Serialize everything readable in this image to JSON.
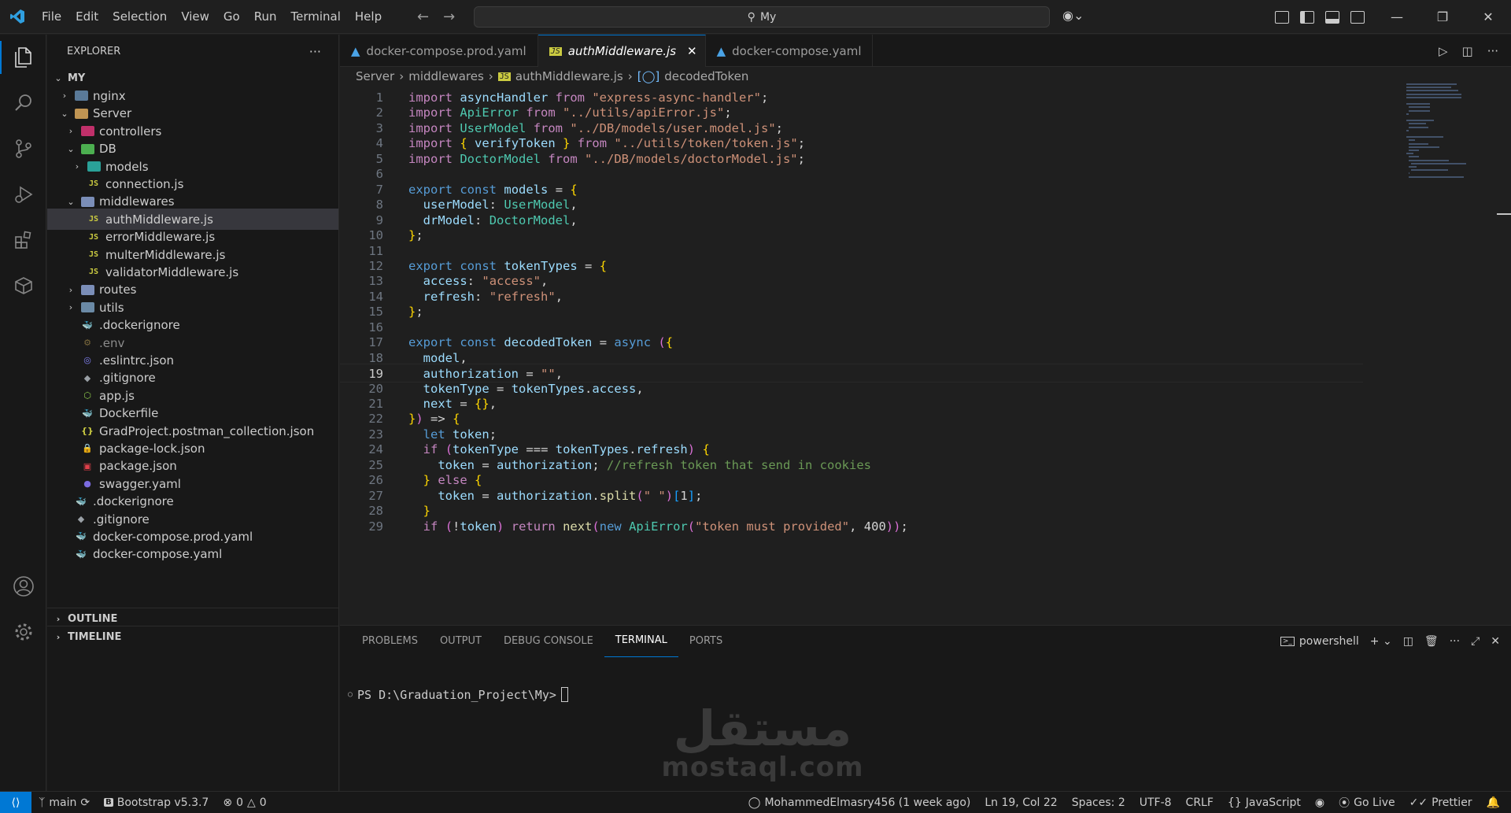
{
  "titlebar": {
    "menu": [
      "File",
      "Edit",
      "Selection",
      "View",
      "Go",
      "Run",
      "Terminal",
      "Help"
    ],
    "search_text": "My"
  },
  "sidebar": {
    "title": "EXPLORER",
    "more": "···",
    "root": "MY",
    "items": [
      {
        "label": "nginx",
        "type": "folder",
        "depth": 1,
        "open": false
      },
      {
        "label": "Server",
        "type": "folder",
        "depth": 1,
        "open": true
      },
      {
        "label": "controllers",
        "type": "folder",
        "depth": 2,
        "open": false
      },
      {
        "label": "DB",
        "type": "folder",
        "depth": 2,
        "open": true
      },
      {
        "label": "models",
        "type": "folder",
        "depth": 3,
        "open": false
      },
      {
        "label": "connection.js",
        "type": "js",
        "depth": 3
      },
      {
        "label": "middlewares",
        "type": "folder",
        "depth": 2,
        "open": true
      },
      {
        "label": "authMiddleware.js",
        "type": "js",
        "depth": 3,
        "selected": true
      },
      {
        "label": "errorMiddleware.js",
        "type": "js",
        "depth": 3
      },
      {
        "label": "multerMiddleware.js",
        "type": "js",
        "depth": 3
      },
      {
        "label": "validatorMiddleware.js",
        "type": "js",
        "depth": 3
      },
      {
        "label": "routes",
        "type": "folder",
        "depth": 2,
        "open": false
      },
      {
        "label": "utils",
        "type": "folder",
        "depth": 2,
        "open": false
      },
      {
        "label": ".dockerignore",
        "type": "docker",
        "depth": 2
      },
      {
        "label": ".env",
        "type": "env",
        "depth": 2
      },
      {
        "label": ".eslintrc.json",
        "type": "eslint",
        "depth": 2
      },
      {
        "label": ".gitignore",
        "type": "git",
        "depth": 2
      },
      {
        "label": "app.js",
        "type": "node",
        "depth": 2
      },
      {
        "label": "Dockerfile",
        "type": "docker",
        "depth": 2
      },
      {
        "label": "GradProject.postman_collection.json",
        "type": "json",
        "depth": 2
      },
      {
        "label": "package-lock.json",
        "type": "lock",
        "depth": 2
      },
      {
        "label": "package.json",
        "type": "npm",
        "depth": 2
      },
      {
        "label": "swagger.yaml",
        "type": "swagger",
        "depth": 2
      },
      {
        "label": ".dockerignore",
        "type": "docker",
        "depth": 1
      },
      {
        "label": ".gitignore",
        "type": "git",
        "depth": 1
      },
      {
        "label": "docker-compose.prod.yaml",
        "type": "docker",
        "depth": 1
      },
      {
        "label": "docker-compose.yaml",
        "type": "docker",
        "depth": 1
      }
    ],
    "outline": "OUTLINE",
    "timeline": "TIMELINE"
  },
  "tabs": [
    {
      "label": "docker-compose.prod.yaml",
      "active": false
    },
    {
      "label": "authMiddleware.js",
      "active": true
    },
    {
      "label": "docker-compose.yaml",
      "active": false
    }
  ],
  "breadcrumb": [
    "Server",
    "middlewares",
    "authMiddleware.js",
    "decodedToken"
  ],
  "code_lines": [
    "import asyncHandler from \"express-async-handler\";",
    "import ApiError from \"../utils/apiError.js\";",
    "import UserModel from \"../DB/models/user.model.js\";",
    "import { verifyToken } from \"../utils/token/token.js\";",
    "import DoctorModel from \"../DB/models/doctorModel.js\";",
    "",
    "export const models = {",
    "  userModel: UserModel,",
    "  drModel: DoctorModel,",
    "};",
    "",
    "export const tokenTypes = {",
    "  access: \"access\",",
    "  refresh: \"refresh\",",
    "};",
    "",
    "export const decodedToken = async ({",
    "  model,",
    "  authorization = \"\",",
    "  tokenType = tokenTypes.access,",
    "  next = {},",
    "}) => {",
    "  let token;",
    "  if (tokenType === tokenTypes.refresh) {",
    "    token = authorization; //refresh token that send in cookies",
    "  } else {",
    "    token = authorization.split(\" \")[1];",
    "  }",
    "  if (!token) return next(new ApiError(\"token must provided\", 400));"
  ],
  "current_line": 19,
  "panel": {
    "tabs": [
      "PROBLEMS",
      "OUTPUT",
      "DEBUG CONSOLE",
      "TERMINAL",
      "PORTS"
    ],
    "active_tab": "TERMINAL",
    "shell": "powershell",
    "prompt": "PS D:\\Graduation_Project\\My>"
  },
  "watermark": {
    "arabic": "مستقل",
    "latin": "mostaql.com"
  },
  "statusbar": {
    "branch": "main",
    "bootstrap": "Bootstrap v5.3.7",
    "errors": "0",
    "warnings": "0",
    "blame": "MohammedElmasry456 (1 week ago)",
    "position": "Ln 19, Col 22",
    "spaces": "Spaces: 2",
    "encoding": "UTF-8",
    "eol": "CRLF",
    "language": "JavaScript",
    "golive": "Go Live",
    "prettier": "Prettier"
  },
  "colors": {
    "accent": "#0078d4",
    "background": "#1f1f1f",
    "sidebar": "#181818"
  }
}
